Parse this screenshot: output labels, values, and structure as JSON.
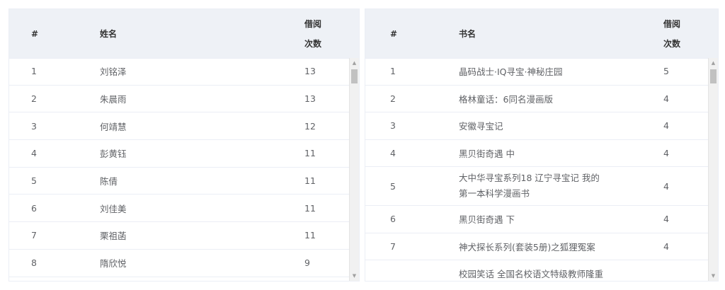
{
  "left_table": {
    "headers": {
      "index": "#",
      "name": "姓名",
      "count_line1": "借阅",
      "count_line2": "次数"
    },
    "rows": [
      {
        "index": "1",
        "name": "刘铭泽",
        "count": "13"
      },
      {
        "index": "2",
        "name": "朱晨雨",
        "count": "13"
      },
      {
        "index": "3",
        "name": "何靖慧",
        "count": "12"
      },
      {
        "index": "4",
        "name": "彭黄钰",
        "count": "11"
      },
      {
        "index": "5",
        "name": "陈倩",
        "count": "11"
      },
      {
        "index": "6",
        "name": "刘佳美",
        "count": "11"
      },
      {
        "index": "7",
        "name": "栗祖菡",
        "count": "11"
      },
      {
        "index": "8",
        "name": "隋欣悦",
        "count": "9"
      }
    ]
  },
  "right_table": {
    "headers": {
      "index": "#",
      "title": "书名",
      "count_line1": "借阅",
      "count_line2": "次数"
    },
    "rows": [
      {
        "index": "1",
        "title": "晶码战士·IQ寻宝·神秘庄园",
        "count": "5"
      },
      {
        "index": "2",
        "title": "格林童话：6同名漫画版",
        "count": "4"
      },
      {
        "index": "3",
        "title": "安徽寻宝记",
        "count": "4"
      },
      {
        "index": "4",
        "title": "黑贝街奇遇 中",
        "count": "4"
      },
      {
        "index": "5",
        "title": "大中华寻宝系列18 辽宁寻宝记 我的第一本科学漫画书",
        "title_line1": "大中华寻宝系列18 辽宁寻宝记 我的",
        "title_line2": "第一本科学漫画书",
        "count": "4"
      },
      {
        "index": "6",
        "title": "黑贝街奇遇 下",
        "count": "4"
      },
      {
        "index": "7",
        "title": "神犬探长系列(套装5册)之狐狸冤案",
        "count": "4"
      },
      {
        "index": "",
        "title": "校园笑话 全国名校语文特级教师隆重",
        "count": ""
      }
    ]
  },
  "icons": {
    "scroll_up": "triangle-up-icon",
    "scroll_down": "triangle-down-icon"
  }
}
